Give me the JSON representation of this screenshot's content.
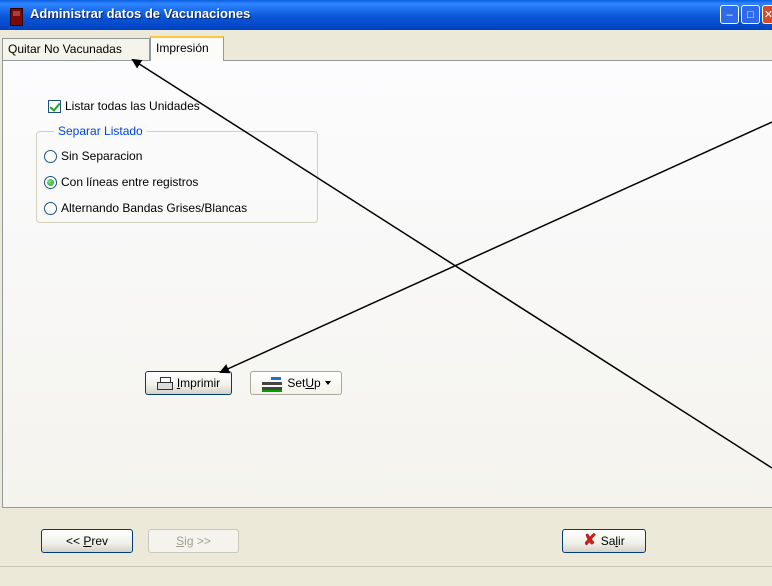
{
  "window": {
    "title": "Administrar datos de Vacunaciones"
  },
  "tabs": [
    {
      "label": "Quitar No Vacunadas"
    },
    {
      "label": "Impresión"
    }
  ],
  "options": {
    "listar_todas": {
      "label": "Listar todas las Unidades",
      "checked": true
    }
  },
  "separar": {
    "legend": "Separar Listado",
    "options": [
      {
        "label": "Sin Separacion",
        "selected": false
      },
      {
        "label": "Con líneas entre registros",
        "selected": true
      },
      {
        "label": "Alternando Bandas Grises/Blancas",
        "selected": false
      }
    ]
  },
  "buttons": {
    "imprimir": {
      "accel": "I",
      "rest": "mprimir"
    },
    "setup": {
      "pre": "Set",
      "accel": "U",
      "post": "p"
    },
    "prev": {
      "pre": "<< ",
      "accel": "P",
      "post": "rev"
    },
    "sig": {
      "accel": "S",
      "post": "ig >>"
    },
    "salir": {
      "pre": "Sa",
      "accel": "l",
      "post": "ir"
    }
  },
  "colors": {
    "title_bar": "#0a57d8",
    "legend_text": "#0046d5",
    "active_tab_accent": "#ffc83c",
    "radio_check": "#21a121",
    "exit_icon": "#c71e1e"
  }
}
